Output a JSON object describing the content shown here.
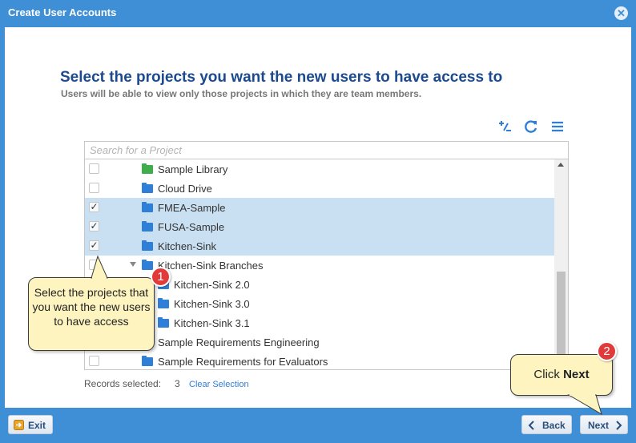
{
  "window": {
    "title": "Create User Accounts"
  },
  "page": {
    "heading": "Select the projects you want the new users to have access to",
    "subheading": "Users will be able to view only those projects in which they are team members."
  },
  "toolbar": {
    "icons": [
      "add-column-icon",
      "refresh-icon",
      "menu-icon"
    ]
  },
  "search": {
    "placeholder": "Search for a Project",
    "value": ""
  },
  "tree": {
    "rows": [
      {
        "label": "Sample Library",
        "checked": false,
        "selected": false,
        "folder": "green"
      },
      {
        "label": "Cloud Drive",
        "checked": false,
        "selected": false,
        "folder": "blue"
      },
      {
        "label": "FMEA-Sample",
        "checked": true,
        "selected": true,
        "folder": "blue"
      },
      {
        "label": "FUSA-Sample",
        "checked": true,
        "selected": true,
        "folder": "blue"
      },
      {
        "label": "Kitchen-Sink",
        "checked": true,
        "selected": true,
        "folder": "blue"
      },
      {
        "label": "Kitchen-Sink Branches",
        "checked": false,
        "selected": false,
        "folder": "blue",
        "expanded": true
      },
      {
        "label": "Kitchen-Sink 2.0",
        "checked": false,
        "selected": false,
        "folder": "blue"
      },
      {
        "label": "Kitchen-Sink 3.0",
        "checked": false,
        "selected": false,
        "folder": "blue"
      },
      {
        "label": "Kitchen-Sink 3.1",
        "checked": false,
        "selected": false,
        "folder": "blue"
      },
      {
        "label": "Sample Requirements Engineering",
        "checked": false,
        "selected": false,
        "folder": "blue"
      },
      {
        "label": "Sample Requirements for Evaluators",
        "checked": false,
        "selected": false,
        "folder": "blue"
      }
    ]
  },
  "records": {
    "label": "Records selected:",
    "count": "3",
    "clear_label": "Clear Selection"
  },
  "callouts": {
    "one": {
      "badge": "1",
      "text": "Select the projects that you want the new users to have access"
    },
    "two": {
      "badge": "2",
      "prefix": "Click ",
      "bold": "Next"
    }
  },
  "footer": {
    "exit_label": "Exit",
    "back_label": "Back",
    "next_label": "Next"
  },
  "colors": {
    "header_blue": "#3f8fd6",
    "heading_navy": "#1b4a8f",
    "selection": "#c9dff2",
    "badge_red": "#e03a3a",
    "callout_yellow": "#fdf4c0"
  }
}
